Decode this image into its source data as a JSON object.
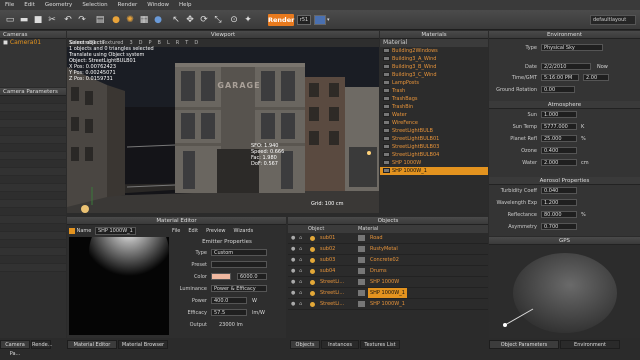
{
  "menu": [
    "File",
    "Edit",
    "Geometry",
    "Selection",
    "Render",
    "Window",
    "Help"
  ],
  "toolbar": {
    "render_label": "Render",
    "res_label": "r51",
    "layout": "defaultlayout"
  },
  "cameras": {
    "title": "Cameras",
    "items": [
      "Camera01"
    ]
  },
  "camera_params": {
    "title": "Camera Parameters"
  },
  "viewport": {
    "title": "Viewport",
    "tabs": [
      "Camera01",
      "Textured",
      "3",
      "D",
      "P",
      "B",
      "L",
      "R",
      "T",
      "D"
    ],
    "info": [
      "Select objects",
      "1 objects and 0 triangles selected",
      "Translate using Object system",
      "Object: StreetLightBULB01",
      "X Pos: 0.00762423",
      "Y Pos: 0.00245071",
      "Z Pos: 0.0159731"
    ],
    "sign": "GARAGE",
    "focal": [
      "SFO: 1.940",
      "Speed: 0.666",
      "Fac: 1.980",
      "DoF: 0.567"
    ],
    "grid_label": "Grid: 100 cm"
  },
  "materials": {
    "title": "Materials",
    "header": "Material",
    "items": [
      "Building2Windows",
      "Building3_A_Wind",
      "Building3_B_Wind",
      "Building3_C_Wind",
      "LampPosts",
      "Trash",
      "TrashBags",
      "TrashBin",
      "Water",
      "WireFence",
      "StreetLightBULB",
      "StreetLightBULB01",
      "StreetLightBULB03",
      "StreetLightBULB04",
      "SHP 1000W",
      "SHP 1000W_1"
    ],
    "selected": "SHP 1000W_1"
  },
  "environment": {
    "title": "Environment",
    "type_label": "Type",
    "type_value": "Physical Sky",
    "date_label": "Date",
    "date_value": "2/2/2010",
    "now_label": "Now",
    "time_label": "Time/GMT",
    "time_value": "5:16:00 PM",
    "gmt_value": "2.00",
    "rotation_label": "Ground Rotation",
    "rotation_value": "0.00",
    "atmosphere_title": "Atmosphere",
    "sun_label": "Sun",
    "sun_value": "1.000",
    "suntemp_label": "Sun Temp",
    "suntemp_value": "5777.000",
    "suntemp_unit": "K",
    "planet_label": "Planet Refl",
    "planet_value": "25.000",
    "planet_unit": "%",
    "ozone_label": "Ozone",
    "ozone_value": "0.400",
    "water_label": "Water",
    "water_value": "2.000",
    "water_unit": "cm",
    "aerosol_title": "Aerosol Properties",
    "turbidity_label": "Turbidity Coeff",
    "turbidity_value": "0.040",
    "wavelength_label": "Wavelength Exp",
    "wavelength_value": "1.200",
    "reflectance_label": "Reflectance",
    "reflectance_value": "80.000",
    "reflectance_unit": "%",
    "asym_label": "Asymmetry",
    "asym_value": "0.700",
    "gps_title": "GPS"
  },
  "material_editor": {
    "title": "Material Editor",
    "name_label": "Name",
    "name_value": "SHP 1000W_1",
    "menu": [
      "File",
      "Edit",
      "Preview",
      "Wizards"
    ],
    "emitter_title": "Emitter Properties",
    "type_label": "Type",
    "type_value": "Custom",
    "preset_label": "Preset",
    "color_label": "Color",
    "color_value": "6000.0",
    "luminance_label": "Luminance",
    "luminance_value": "Power & Efficacy",
    "power_label": "Power",
    "power_value": "400.0",
    "power_unit": "W",
    "efficacy_label": "Efficacy",
    "efficacy_value": "57.5",
    "efficacy_unit": "lm/W",
    "output_label": "Output",
    "output_value": "23000 lm"
  },
  "objects": {
    "title": "Objects",
    "col_object": "Object",
    "col_material": "Material",
    "rows": [
      {
        "obj": "sub01",
        "mat": "Road"
      },
      {
        "obj": "sub02",
        "mat": "RustyMetal"
      },
      {
        "obj": "sub03",
        "mat": "Concrete02"
      },
      {
        "obj": "sub04",
        "mat": "Drums"
      },
      {
        "obj": "StreetLi...",
        "mat": "SHP 1000W"
      },
      {
        "obj": "StreetLi...",
        "mat": "SHP 1000W_1"
      },
      {
        "obj": "StreetLi...",
        "mat": "SHP 1000W_1"
      }
    ]
  },
  "bottom_tabs": {
    "left": [
      "Camera Pa...",
      "Rende..."
    ],
    "mid": [
      "Material Editor",
      "Material Browser"
    ],
    "obj": [
      "Objects",
      "Instances",
      "Textures List"
    ],
    "env": [
      "Object Parameters",
      "Environment"
    ]
  },
  "colors": {
    "accent": "#e3931f",
    "render": "#e87a1e",
    "panel": "#343434"
  }
}
